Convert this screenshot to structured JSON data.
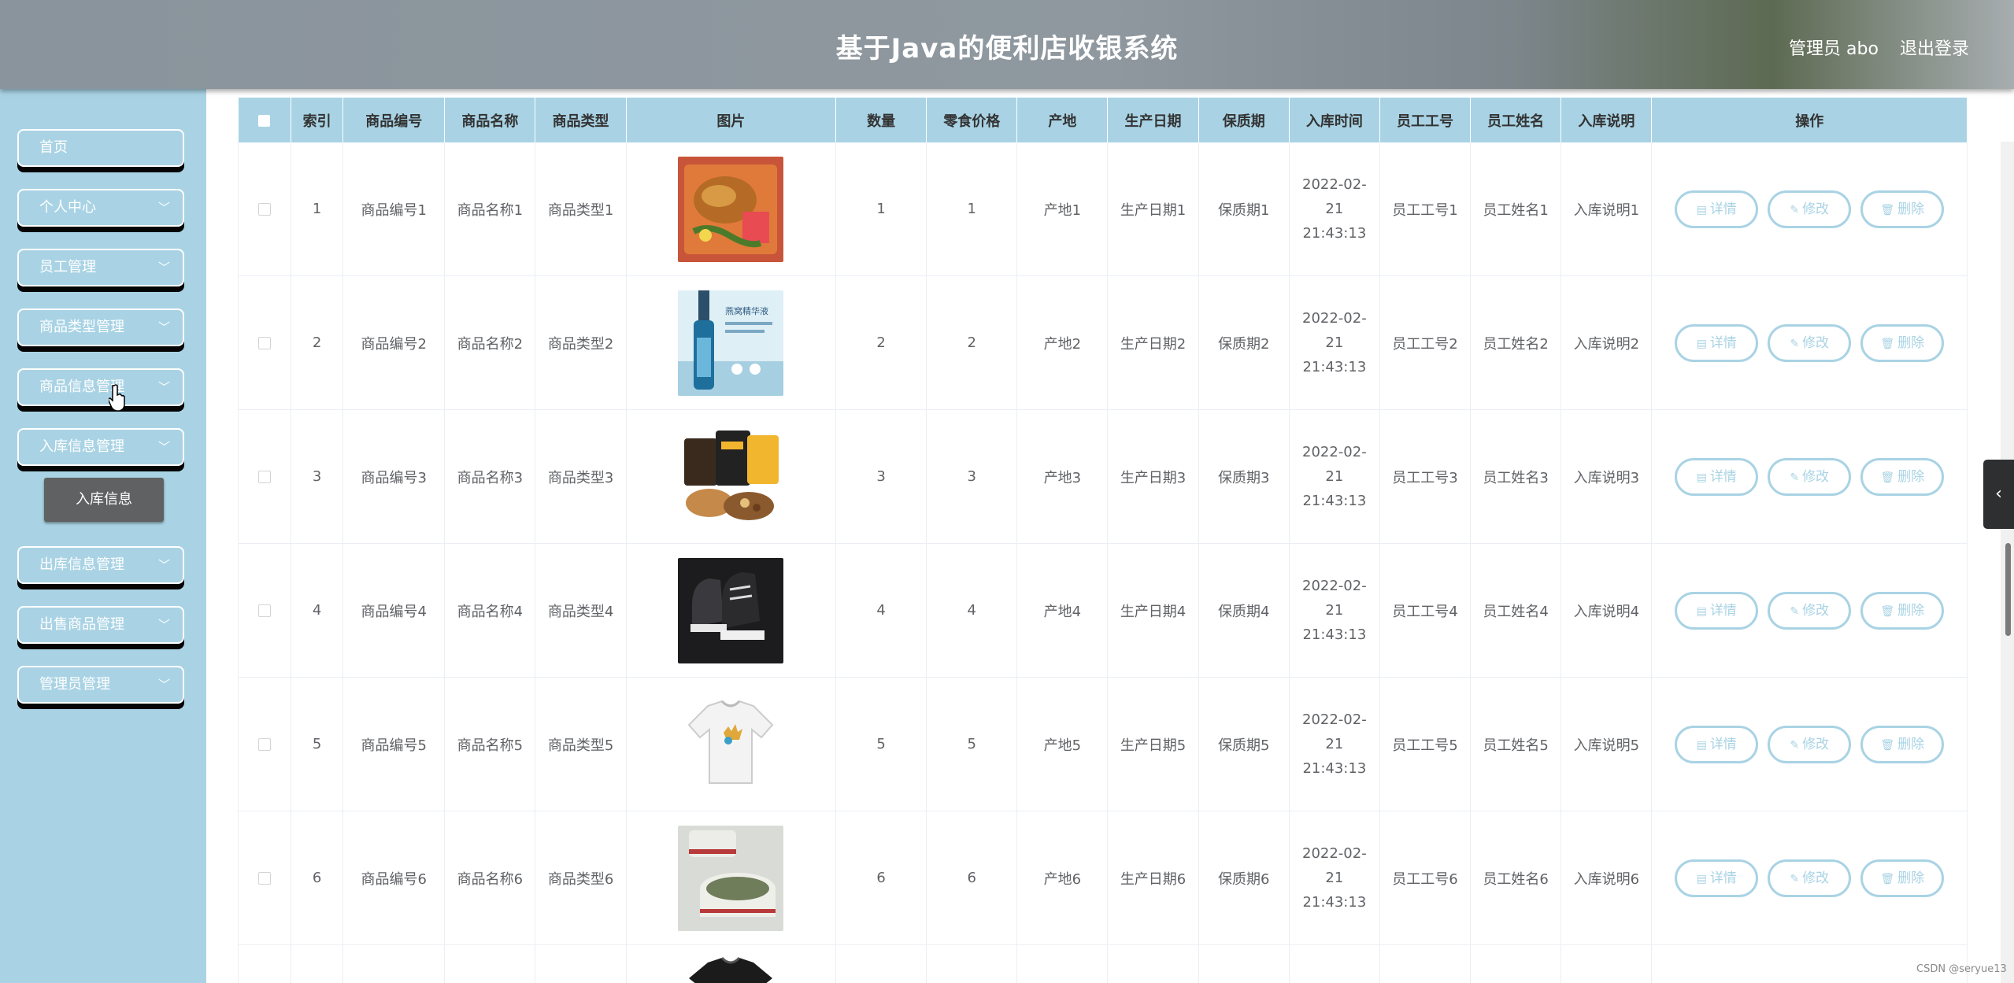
{
  "app": {
    "title": "基于Java的便利店收银系统",
    "user": "管理员 abo",
    "logout": "退出登录"
  },
  "sidebar": {
    "items": [
      {
        "label": "首页",
        "has_arrow": false
      },
      {
        "label": "个人中心",
        "has_arrow": true
      },
      {
        "label": "员工管理",
        "has_arrow": true
      },
      {
        "label": "商品类型管理",
        "has_arrow": true
      },
      {
        "label": "商品信息管理",
        "has_arrow": true
      },
      {
        "label": "入库信息管理",
        "has_arrow": true
      },
      {
        "label": "出库信息管理",
        "has_arrow": true
      },
      {
        "label": "出售商品管理",
        "has_arrow": true
      },
      {
        "label": "管理员管理",
        "has_arrow": true
      }
    ],
    "submenu": {
      "label": "入库信息"
    }
  },
  "table": {
    "headers": [
      "索引",
      "商品编号",
      "商品名称",
      "商品类型",
      "图片",
      "数量",
      "零食价格",
      "产地",
      "生产日期",
      "保质期",
      "入库时间",
      "员工工号",
      "员工姓名",
      "入库说明",
      "操作"
    ],
    "rows": [
      {
        "index": "1",
        "code": "商品编号1",
        "name": "商品名称1",
        "type": "商品类型1",
        "image": "fried-chicken-meal",
        "qty": "1",
        "price": "1",
        "origin": "产地1",
        "prod_date": "生产日期1",
        "shelf": "保质期1",
        "time": "2022-02-21 21:43:13",
        "emp_no": "员工工号1",
        "emp_name": "员工姓名1",
        "note": "入库说明1"
      },
      {
        "index": "2",
        "code": "商品编号2",
        "name": "商品名称2",
        "type": "商品类型2",
        "image": "serum-bottle",
        "qty": "2",
        "price": "2",
        "origin": "产地2",
        "prod_date": "生产日期2",
        "shelf": "保质期2",
        "time": "2022-02-21 21:43:13",
        "emp_no": "员工工号2",
        "emp_name": "员工姓名2",
        "note": "入库说明2"
      },
      {
        "index": "3",
        "code": "商品编号3",
        "name": "商品名称3",
        "type": "商品类型3",
        "image": "snack-bags",
        "qty": "3",
        "price": "3",
        "origin": "产地3",
        "prod_date": "生产日期3",
        "shelf": "保质期3",
        "time": "2022-02-21 21:43:13",
        "emp_no": "员工工号3",
        "emp_name": "员工姓名3",
        "note": "入库说明3"
      },
      {
        "index": "4",
        "code": "商品编号4",
        "name": "商品名称4",
        "type": "商品类型4",
        "image": "sneakers",
        "qty": "4",
        "price": "4",
        "origin": "产地4",
        "prod_date": "生产日期4",
        "shelf": "保质期4",
        "time": "2022-02-21 21:43:13",
        "emp_no": "员工工号4",
        "emp_name": "员工姓名4",
        "note": "入库说明4"
      },
      {
        "index": "5",
        "code": "商品编号5",
        "name": "商品名称5",
        "type": "商品类型5",
        "image": "white-tshirt",
        "qty": "5",
        "price": "5",
        "origin": "产地5",
        "prod_date": "生产日期5",
        "shelf": "保质期5",
        "time": "2022-02-21 21:43:13",
        "emp_no": "员工工号5",
        "emp_name": "员工姓名5",
        "note": "入库说明5"
      },
      {
        "index": "6",
        "code": "商品编号6",
        "name": "商品名称6",
        "type": "商品类型6",
        "image": "cream-jar",
        "qty": "6",
        "price": "6",
        "origin": "产地6",
        "prod_date": "生产日期6",
        "shelf": "保质期6",
        "time": "2022-02-21 21:43:13",
        "emp_no": "员工工号6",
        "emp_name": "员工姓名6",
        "note": "入库说明6"
      }
    ],
    "partial_row_image": "black-tshirt",
    "actions": {
      "detail": "详情",
      "edit": "修改",
      "delete": "删除"
    },
    "action_icons": {
      "detail": "document-icon",
      "edit": "pencil-icon",
      "delete": "trash-icon"
    }
  },
  "side_tab": {
    "icon": "chevron-left-icon"
  },
  "watermark": "CSDN @seryue13",
  "colors": {
    "accent": "#a9d3e4",
    "header": "#8f989f",
    "submenu": "#5f6163"
  }
}
